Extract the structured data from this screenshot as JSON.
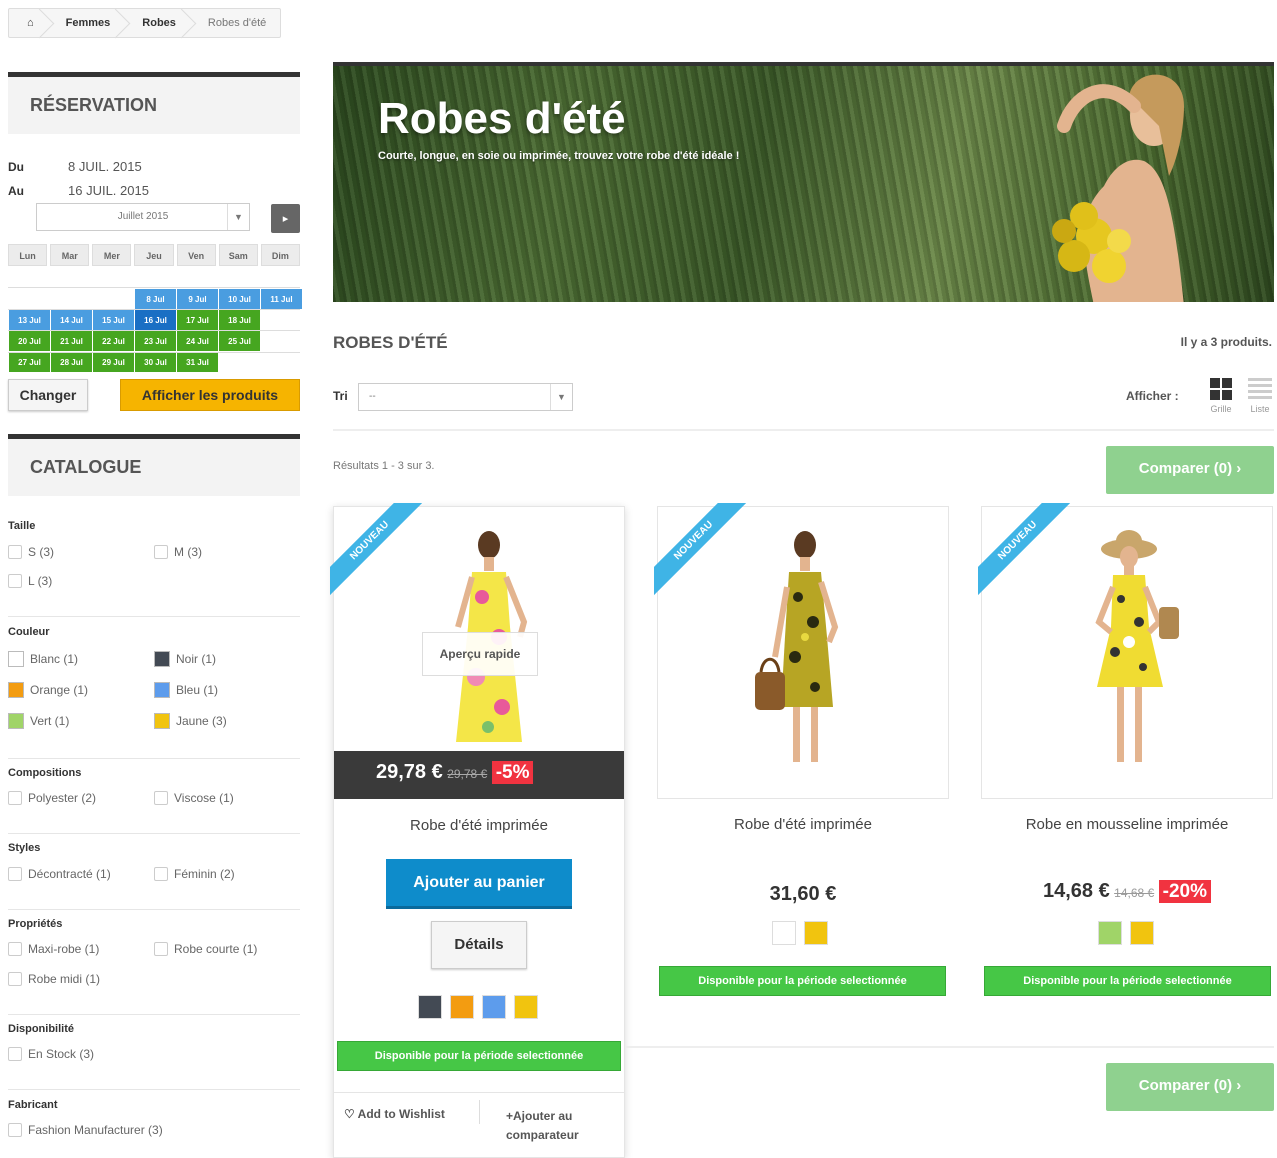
{
  "breadcrumb": {
    "home_icon": "home-icon",
    "items": [
      "Femmes",
      "Robes",
      "Robes d'été"
    ]
  },
  "reservation": {
    "title": "RÉSERVATION",
    "from_label": "Du",
    "from_value": "8 JUIL. 2015",
    "to_label": "Au",
    "to_value": "16 JUIL. 2015",
    "month_select": "Juillet 2015",
    "next_icon": "▸",
    "days": [
      "Lun",
      "Mar",
      "Mer",
      "Jeu",
      "Ven",
      "Sam",
      "Dim"
    ],
    "weeks": [
      [
        "",
        "",
        "",
        "8 Jul",
        "9 Jul",
        "10 Jul",
        "11 Jul"
      ],
      [
        "13 Jul",
        "14 Jul",
        "15 Jul",
        "16 Jul",
        "17 Jul",
        "18 Jul",
        ""
      ],
      [
        "20 Jul",
        "21 Jul",
        "22 Jul",
        "23 Jul",
        "24 Jul",
        "25 Jul",
        ""
      ],
      [
        "27 Jul",
        "28 Jul",
        "29 Jul",
        "30 Jul",
        "31 Jul",
        "",
        ""
      ]
    ],
    "change_label": "Changer",
    "show_label": "Afficher les produits"
  },
  "catalog": {
    "title": "CATALOGUE",
    "size": {
      "title": "Taille",
      "items": [
        "S (3)",
        "M (3)",
        "L (3)"
      ]
    },
    "color": {
      "title": "Couleur",
      "items": [
        {
          "label": "Blanc (1)",
          "color": "#ffffff"
        },
        {
          "label": "Noir (1)",
          "color": "#434a54"
        },
        {
          "label": "Orange (1)",
          "color": "#f39c11"
        },
        {
          "label": "Bleu (1)",
          "color": "#5d9cec"
        },
        {
          "label": "Vert (1)",
          "color": "#a0d468"
        },
        {
          "label": "Jaune (3)",
          "color": "#f1c40f"
        }
      ]
    },
    "composition": {
      "title": "Compositions",
      "items": [
        "Polyester (2)",
        "Viscose (1)"
      ]
    },
    "styles": {
      "title": "Styles",
      "items": [
        "Décontracté (1)",
        "Féminin (2)"
      ]
    },
    "properties": {
      "title": "Propriétés",
      "items": [
        "Maxi-robe (1)",
        "Robe courte (1)",
        "Robe midi (1)"
      ]
    },
    "availability": {
      "title": "Disponibilité",
      "items": [
        "En Stock (3)"
      ]
    },
    "manufacturer": {
      "title": "Fabricant",
      "items": [
        "Fashion Manufacturer (3)"
      ]
    }
  },
  "banner": {
    "title": "Robes d'été",
    "subtitle": "Courte, longue, en soie ou imprimée, trouvez votre robe d'été idéale !"
  },
  "listing": {
    "title": "ROBES D'ÉTÉ",
    "count": "Il y a 3 produits.",
    "sort_label": "Tri",
    "sort_value": "--",
    "view_label": "Afficher :",
    "grid_label": "Grille",
    "list_label": "Liste",
    "results": "Résultats 1 - 3 sur 3.",
    "compare_label": "Comparer (0)"
  },
  "products": [
    {
      "badge": "NOUVEAU",
      "name": "Robe d'été imprimée",
      "price": "29,78 €",
      "old_price": "29,78 €",
      "discount": "-5%",
      "quick_view": "Aperçu rapide",
      "add_cart": "Ajouter au panier",
      "details": "Détails",
      "colors": [
        "#434a54",
        "#f39c11",
        "#5d9cec",
        "#f1c40f"
      ],
      "availability": "Disponible pour la période selectionnée",
      "wishlist": "Add to Wishlist",
      "compare": "Ajouter au comparateur"
    },
    {
      "badge": "NOUVEAU",
      "name": "Robe d'été imprimée",
      "price": "31,60 €",
      "colors": [
        "#ffffff",
        "#f1c40f"
      ],
      "availability": "Disponible pour la période selectionnée"
    },
    {
      "badge": "NOUVEAU",
      "name": "Robe en mousseline imprimée",
      "price": "14,68 €",
      "old_price": "14,68 €",
      "discount": "-20%",
      "colors": [
        "#a0d468",
        "#f1c40f"
      ],
      "availability": "Disponible pour la période selectionnée"
    }
  ]
}
